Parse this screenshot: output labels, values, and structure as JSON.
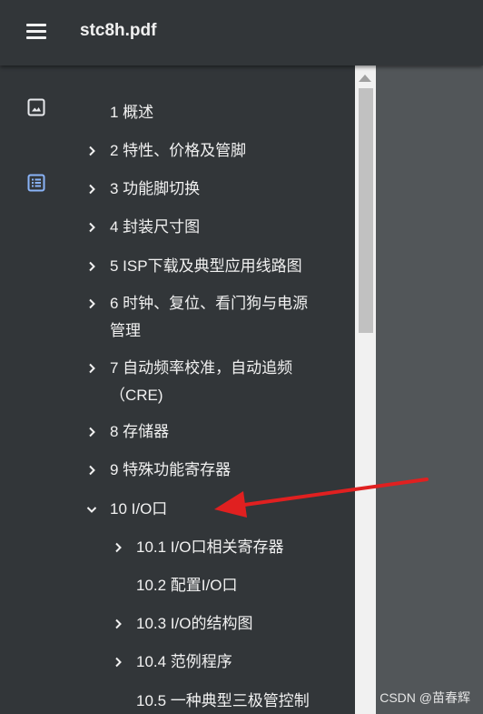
{
  "toolbar": {
    "title": "stc8h.pdf"
  },
  "outline": [
    {
      "label": "1 概述",
      "expander": "none"
    },
    {
      "label": "2 特性、价格及管脚",
      "expander": "collapsed"
    },
    {
      "label": "3 功能脚切换",
      "expander": "collapsed"
    },
    {
      "label": "4 封装尺寸图",
      "expander": "collapsed"
    },
    {
      "label": "5 ISP下载及典型应用线路图",
      "expander": "collapsed"
    },
    {
      "label_line1": "6 时钟、复位、看门狗与电源",
      "label_line2": "管理",
      "expander": "collapsed"
    },
    {
      "label_line1": "7 自动频率校准，自动追频",
      "label_line2": "（CRE)",
      "expander": "collapsed"
    },
    {
      "label": "8 存储器",
      "expander": "collapsed"
    },
    {
      "label": "9 特殊功能寄存器",
      "expander": "collapsed"
    },
    {
      "label": "10 I/O口",
      "expander": "expanded"
    },
    {
      "label": "10.1 I/O口相关寄存器",
      "expander": "collapsed"
    },
    {
      "label": "10.2 配置I/O口",
      "expander": "none"
    },
    {
      "label": "10.3 I/O的结构图",
      "expander": "collapsed"
    },
    {
      "label": "10.4 范例程序",
      "expander": "collapsed"
    },
    {
      "label": "10.5 一种典型三极管控制",
      "expander": "none"
    }
  ],
  "watermark": "CSDN @苗春辉",
  "colors": {
    "annotation_arrow": "#e02020",
    "outline_icon_active": "#8ab4f8"
  }
}
